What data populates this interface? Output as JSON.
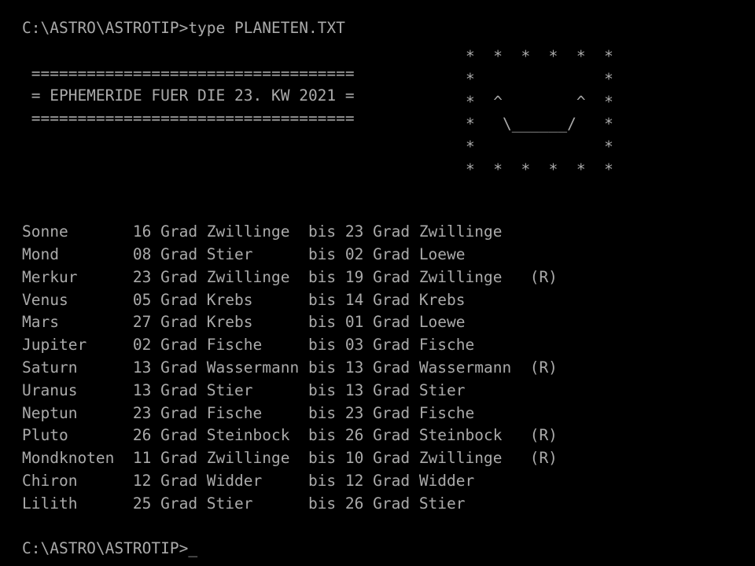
{
  "terminal": {
    "colors": {
      "background": "#000000",
      "foreground": "#aaaaaa"
    },
    "prompt_top": "C:\\ASTRO\\ASTROTIP>type PLANETEN.TXT",
    "prompt_bottom": "C:\\ASTRO\\ASTROTIP>",
    "cursor": "_"
  },
  "banner": {
    "rule_top": " ===================================",
    "title_line": " = EPHEMERIDE FUER DIE 23. KW 2021 =",
    "rule_bottom": " ===================================",
    "title_text": "EPHEMERIDE FUER DIE 23. KW 2021",
    "week": "23. KW",
    "year": "2021"
  },
  "ascii_art": {
    "name": "smiley-face",
    "rows": [
      "*  *  *  *  *  *",
      "*              *",
      "*  ^        ^  *",
      "*   \\______/   *",
      "*              *",
      "*  *  *  *  *  *"
    ]
  },
  "table": {
    "columns": [
      "body",
      "start_degree",
      "start_unit",
      "start_sign",
      "connector",
      "end_degree",
      "end_unit",
      "end_sign",
      "retrograde"
    ],
    "connector_label": "bis",
    "unit_label": "Grad",
    "retrograde_label": "(R)",
    "rows": [
      {
        "body": "Sonne",
        "start_degree": "16",
        "start_unit": "Grad",
        "start_sign": "Zwillinge",
        "connector": "bis",
        "end_degree": "23",
        "end_unit": "Grad",
        "end_sign": "Zwillinge",
        "retrograde": ""
      },
      {
        "body": "Mond",
        "start_degree": "08",
        "start_unit": "Grad",
        "start_sign": "Stier",
        "connector": "bis",
        "end_degree": "02",
        "end_unit": "Grad",
        "end_sign": "Loewe",
        "retrograde": ""
      },
      {
        "body": "Merkur",
        "start_degree": "23",
        "start_unit": "Grad",
        "start_sign": "Zwillinge",
        "connector": "bis",
        "end_degree": "19",
        "end_unit": "Grad",
        "end_sign": "Zwillinge",
        "retrograde": "(R)"
      },
      {
        "body": "Venus",
        "start_degree": "05",
        "start_unit": "Grad",
        "start_sign": "Krebs",
        "connector": "bis",
        "end_degree": "14",
        "end_unit": "Grad",
        "end_sign": "Krebs",
        "retrograde": ""
      },
      {
        "body": "Mars",
        "start_degree": "27",
        "start_unit": "Grad",
        "start_sign": "Krebs",
        "connector": "bis",
        "end_degree": "01",
        "end_unit": "Grad",
        "end_sign": "Loewe",
        "retrograde": ""
      },
      {
        "body": "Jupiter",
        "start_degree": "02",
        "start_unit": "Grad",
        "start_sign": "Fische",
        "connector": "bis",
        "end_degree": "03",
        "end_unit": "Grad",
        "end_sign": "Fische",
        "retrograde": ""
      },
      {
        "body": "Saturn",
        "start_degree": "13",
        "start_unit": "Grad",
        "start_sign": "Wassermann",
        "connector": "bis",
        "end_degree": "13",
        "end_unit": "Grad",
        "end_sign": "Wassermann",
        "retrograde": "(R)"
      },
      {
        "body": "Uranus",
        "start_degree": "13",
        "start_unit": "Grad",
        "start_sign": "Stier",
        "connector": "bis",
        "end_degree": "13",
        "end_unit": "Grad",
        "end_sign": "Stier",
        "retrograde": ""
      },
      {
        "body": "Neptun",
        "start_degree": "23",
        "start_unit": "Grad",
        "start_sign": "Fische",
        "connector": "bis",
        "end_degree": "23",
        "end_unit": "Grad",
        "end_sign": "Fische",
        "retrograde": ""
      },
      {
        "body": "Pluto",
        "start_degree": "26",
        "start_unit": "Grad",
        "start_sign": "Steinbock",
        "connector": "bis",
        "end_degree": "26",
        "end_unit": "Grad",
        "end_sign": "Steinbock",
        "retrograde": "(R)"
      },
      {
        "body": "Mondknoten",
        "start_degree": "11",
        "start_unit": "Grad",
        "start_sign": "Zwillinge",
        "connector": "bis",
        "end_degree": "10",
        "end_unit": "Grad",
        "end_sign": "Zwillinge",
        "retrograde": "(R)"
      },
      {
        "body": "Chiron",
        "start_degree": "12",
        "start_unit": "Grad",
        "start_sign": "Widder",
        "connector": "bis",
        "end_degree": "12",
        "end_unit": "Grad",
        "end_sign": "Widder",
        "retrograde": ""
      },
      {
        "body": "Lilith",
        "start_degree": "25",
        "start_unit": "Grad",
        "start_sign": "Stier",
        "connector": "bis",
        "end_degree": "26",
        "end_unit": "Grad",
        "end_sign": "Stier",
        "retrograde": ""
      }
    ]
  }
}
